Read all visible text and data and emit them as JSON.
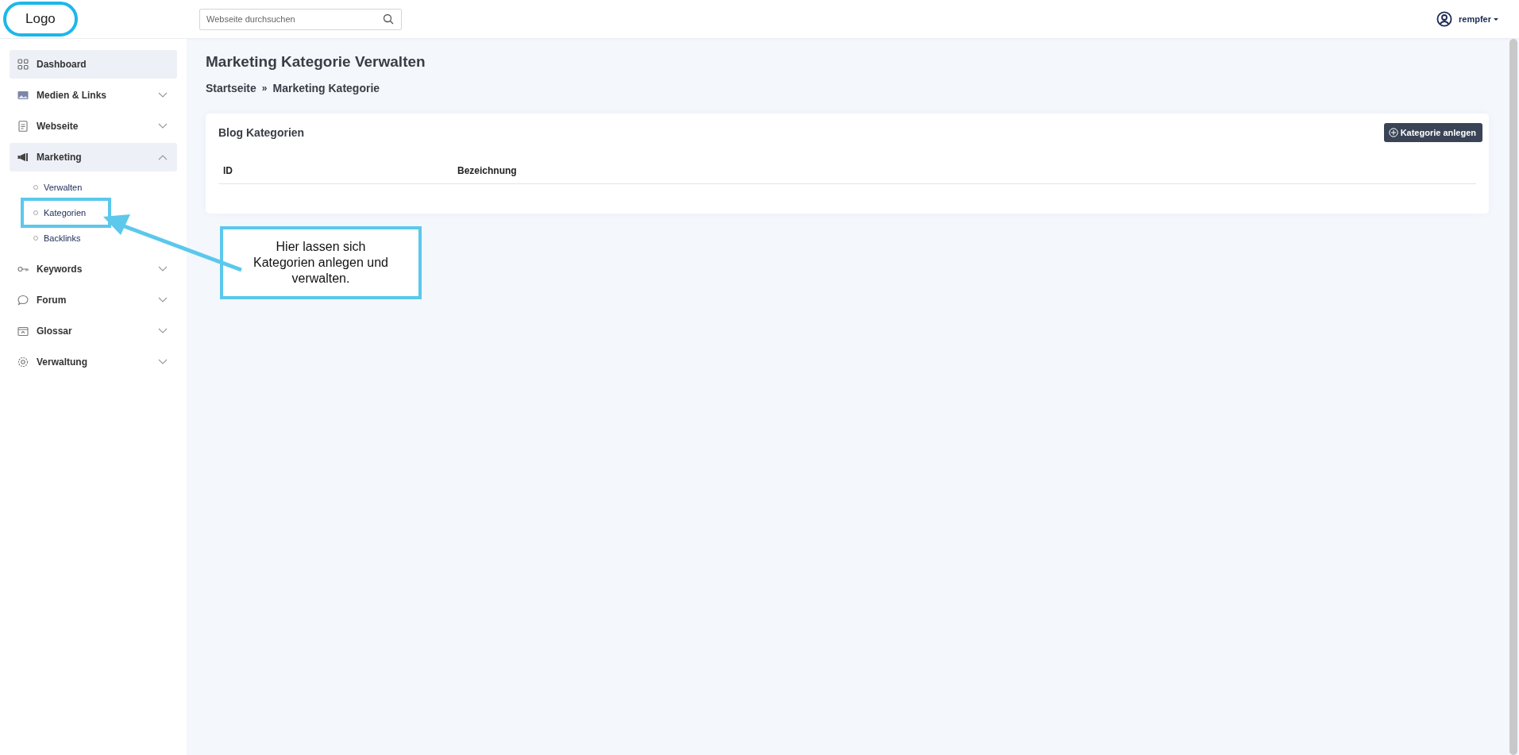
{
  "logo": "Logo",
  "search": {
    "placeholder": "Webseite durchsuchen"
  },
  "user": {
    "name": "rempfer"
  },
  "sidebar": {
    "items": [
      {
        "label": "Dashboard",
        "kind": "link",
        "selected": true
      },
      {
        "label": "Medien & Links",
        "kind": "group",
        "selected": false,
        "expanded": false
      },
      {
        "label": "Webseite",
        "kind": "group",
        "selected": false,
        "expanded": false
      },
      {
        "label": "Marketing",
        "kind": "group",
        "selected": true,
        "expanded": true,
        "children": [
          {
            "label": "Verwalten",
            "annotated": false
          },
          {
            "label": "Kategorien",
            "annotated": true
          },
          {
            "label": "Backlinks",
            "annotated": false
          }
        ]
      },
      {
        "label": "Keywords",
        "kind": "group",
        "selected": false,
        "expanded": false
      },
      {
        "label": "Forum",
        "kind": "group",
        "selected": false,
        "expanded": false
      },
      {
        "label": "Glossar",
        "kind": "group",
        "selected": false,
        "expanded": false
      },
      {
        "label": "Verwaltung",
        "kind": "group",
        "selected": false,
        "expanded": false
      }
    ]
  },
  "page": {
    "title": "Marketing Kategorie Verwalten",
    "breadcrumb": [
      "Startseite",
      "»",
      "Marketing Kategorie"
    ]
  },
  "card": {
    "title": "Blog Kategorien",
    "button": "Kategorie anlegen",
    "table": {
      "columns": [
        "ID",
        "Bezeichnung"
      ]
    }
  },
  "callout": {
    "text": "Hier lassen sich Kategorien anlegen und verwalten."
  }
}
